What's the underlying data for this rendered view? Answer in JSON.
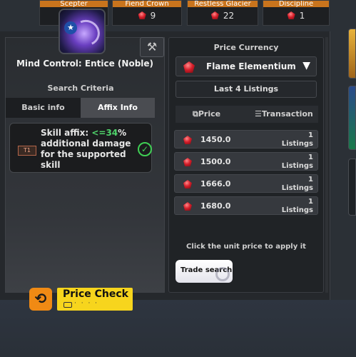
{
  "top_items": [
    {
      "caption": "Scepter",
      "count": ""
    },
    {
      "caption": "Fiend Crown",
      "count": "9"
    },
    {
      "caption": "Restless Glacier",
      "count": "22"
    },
    {
      "caption": "Discipline",
      "count": "1"
    }
  ],
  "skill": {
    "name": "Mind Control: Entice (Noble)"
  },
  "search": {
    "title": "Search Criteria",
    "tabs": [
      "Basic info",
      "Affix Info"
    ],
    "active_tab": "Affix Info",
    "affix": {
      "tier": "T1",
      "prefix": "Skill affix: ",
      "value": "<=34",
      "rest": "% additional damage for the supported skill"
    }
  },
  "price": {
    "currency_title": "Price Currency",
    "currency": "Flame Elementium",
    "listings_button": "Last 4 Listings",
    "col_price": "Price",
    "col_transaction": "Transaction",
    "rows": [
      {
        "price": "1450.0",
        "count": "1",
        "unit": "Listings"
      },
      {
        "price": "1500.0",
        "count": "1",
        "unit": "Listings"
      },
      {
        "price": "1666.0",
        "count": "1",
        "unit": "Listings"
      },
      {
        "price": "1680.0",
        "count": "1",
        "unit": "Listings"
      }
    ],
    "hint": "Click the unit price to apply it",
    "trade_search": "Trade search"
  },
  "price_check": {
    "label": "Price Check",
    "dots": "· · · ·"
  },
  "colors": {
    "accent_orange": "#c9741d",
    "price_check_yellow": "#f7d51d",
    "affix_green": "#4fd26a",
    "gem_red": "#d61e2a"
  }
}
